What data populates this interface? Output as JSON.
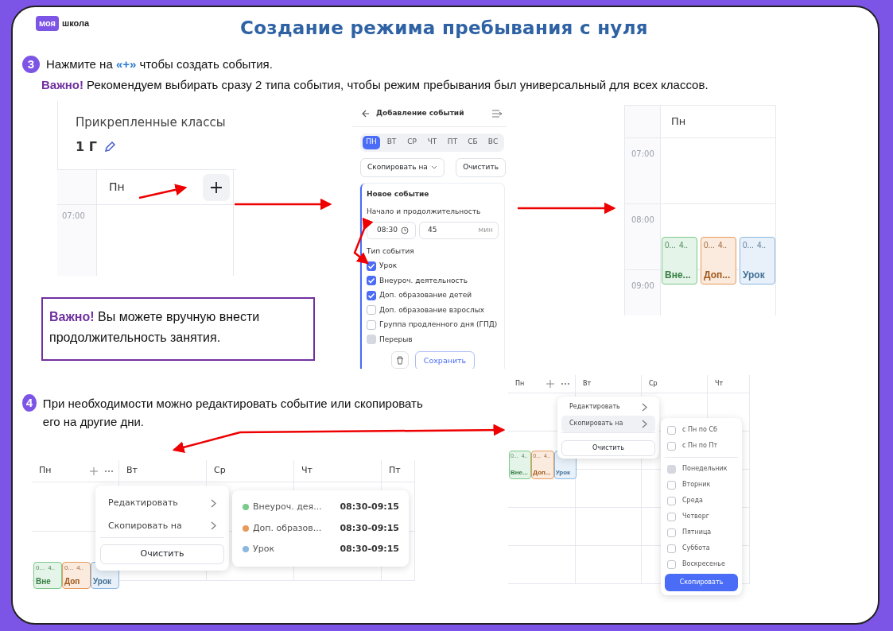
{
  "logo": {
    "badge": "моя",
    "word": "школа"
  },
  "title": "Создание режима пребывания с нуля",
  "step3": {
    "number": "3",
    "text": "Нажмите на **«+»** чтобы создать события.",
    "note_label": "Важно!",
    "note": "Рекомендуем выбирать сразу 2 типа события, чтобы режим пребывания был универсальный для всех классов."
  },
  "classes_panel": {
    "title": "Прикрепленные классы",
    "class_name": "1 Г",
    "column": "Пн",
    "time": "07:00"
  },
  "add_panel": {
    "title": "Добавление событий",
    "days": [
      {
        "label": "ПН",
        "selected": true
      },
      {
        "label": "ВТ",
        "selected": false
      },
      {
        "label": "СР",
        "selected": false
      },
      {
        "label": "ЧТ",
        "selected": false
      },
      {
        "label": "ПТ",
        "selected": false
      },
      {
        "label": "СБ",
        "selected": false
      },
      {
        "label": "ВС",
        "selected": false
      }
    ],
    "copy_button": "Скопировать на",
    "clear_button": "Очистить",
    "form_title": "Новое событие",
    "start_label": "Начало и продолжительность",
    "start_value": "08:30",
    "duration_value": "45",
    "duration_unit": "мин",
    "type_label": "Тип события",
    "types": [
      {
        "label": "Урок",
        "checked": true,
        "disabled": false
      },
      {
        "label": "Внеуроч. деятельность",
        "checked": true,
        "disabled": false
      },
      {
        "label": "Доп. образование детей",
        "checked": true,
        "disabled": false
      },
      {
        "label": "Доп. образование взрослых",
        "checked": false,
        "disabled": false
      },
      {
        "label": "Группа продленного дня (ГПД)",
        "checked": false,
        "disabled": false
      },
      {
        "label": "Перерыв",
        "checked": false,
        "disabled": true
      }
    ],
    "save_button": "Сохранить"
  },
  "schedule_panel": {
    "column": "Пн",
    "times": [
      "07:00",
      "08:00",
      "09:00"
    ],
    "events": [
      {
        "time": "0...",
        "duration": "4..",
        "title": "Вне...",
        "color": "#7cc98b"
      },
      {
        "time": "0...",
        "duration": "4..",
        "title": "Доп...",
        "color": "#e89a5b"
      },
      {
        "time": "0...",
        "duration": "4..",
        "title": "Урок",
        "color": "#8ab8e0"
      }
    ]
  },
  "note_box": {
    "label": "Важно!",
    "text": "Вы можете вручную внести продолжительность  занятия."
  },
  "step4": {
    "number": "4",
    "text": "При необходимости можно редактировать событие или скопировать его на другие дни."
  },
  "edit_panel": {
    "columns": [
      "Пн",
      "Вт",
      "Ср",
      "Чт",
      "Пт"
    ],
    "events": [
      {
        "time": "0...",
        "duration": "4..",
        "title": "Вне",
        "color": "#7cc98b"
      },
      {
        "time": "0...",
        "duration": "4..",
        "title": "Доп",
        "color": "#e89a5b"
      },
      {
        "title": "Урок",
        "color": "#8ab8e0"
      }
    ],
    "menu": [
      {
        "label": "Редактировать",
        "selected": false
      },
      {
        "label": "Скопировать на",
        "selected": false
      }
    ],
    "clear_button": "Очистить",
    "submenu": [
      {
        "title": "Внеуроч. дея...",
        "time": "08:30-09:15",
        "color": "#7cc98b"
      },
      {
        "title": "Доп. образов...",
        "time": "08:30-09:15",
        "color": "#e89a5b"
      },
      {
        "title": "Урок",
        "time": "08:30-09:15",
        "color": "#8ab8e0"
      }
    ]
  },
  "copy_panel": {
    "columns": [
      "Пн",
      "Вт",
      "Ср",
      "Чт"
    ],
    "events": [
      {
        "time": "0...",
        "duration": "4..",
        "title": "Вне...",
        "color": "#7cc98b"
      },
      {
        "time": "0...",
        "duration": "4..",
        "title": "Доп...",
        "color": "#e89a5b"
      },
      {
        "title": "Урок",
        "color": "#8ab8e0"
      }
    ],
    "menu": [
      {
        "label": "Редактировать",
        "selected": false
      },
      {
        "label": "Скопировать на",
        "selected": true
      }
    ],
    "clear_button": "Очистить",
    "ranges": [
      {
        "label": "с Пн по Сб",
        "checked": false,
        "disabled": false
      },
      {
        "label": "с Пн по Пт",
        "checked": false,
        "disabled": false
      }
    ],
    "days": [
      {
        "label": "Понедельник",
        "checked": false,
        "disabled": true
      },
      {
        "label": "Вторник",
        "checked": false,
        "disabled": false
      },
      {
        "label": "Среда",
        "checked": false,
        "disabled": false
      },
      {
        "label": "Четверг",
        "checked": false,
        "disabled": false
      },
      {
        "label": "Пятница",
        "checked": false,
        "disabled": false
      },
      {
        "label": "Суббота",
        "checked": false,
        "disabled": false
      },
      {
        "label": "Воскресенье",
        "checked": false,
        "disabled": false
      }
    ],
    "copy_button": "Скопировать"
  }
}
